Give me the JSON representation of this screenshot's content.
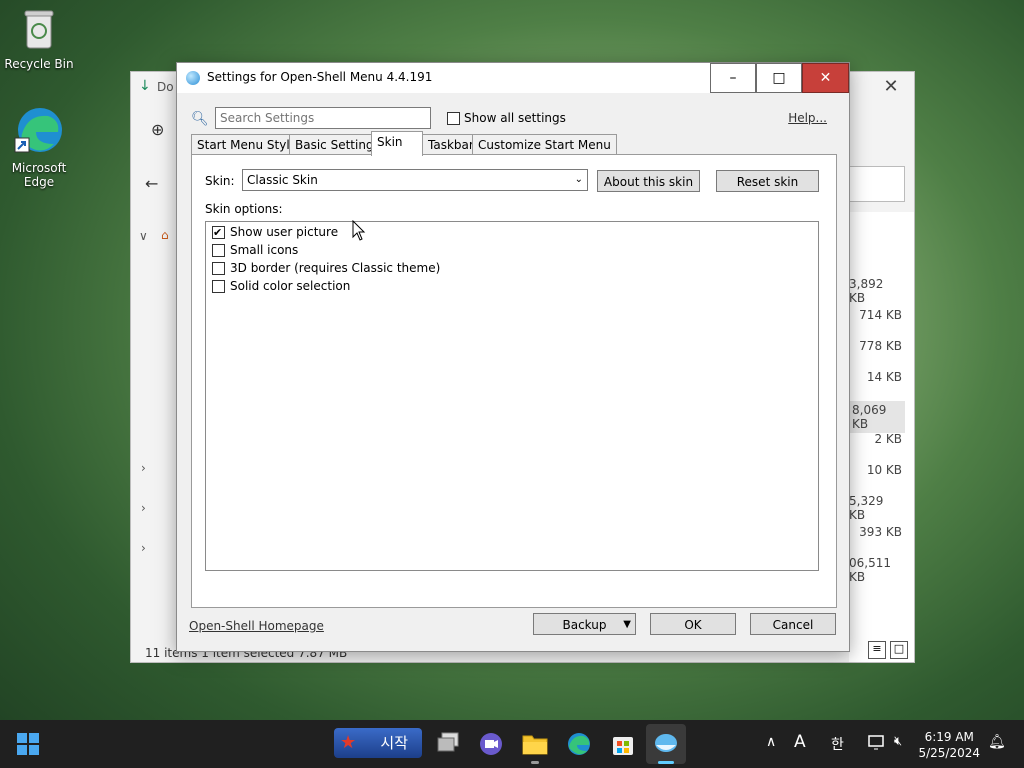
{
  "desktop": {
    "icons": [
      {
        "label": "Recycle Bin"
      },
      {
        "label": "Microsoft Edge"
      }
    ]
  },
  "explorer": {
    "title_partial": "Do",
    "sizes": [
      "3,892 KB",
      "714 KB",
      "778 KB",
      "14 KB",
      "8,069 KB",
      "2 KB",
      "10 KB",
      "5,329 KB",
      "393 KB",
      "06,511 KB"
    ],
    "status": "11 items    1 item selected  7.87 MB"
  },
  "dialog": {
    "title": "Settings for Open-Shell Menu 4.4.191",
    "search_placeholder": "Search Settings",
    "show_all_label": "Show all settings",
    "help_label": "Help...",
    "tabs": [
      {
        "label": "Start Menu Style"
      },
      {
        "label": "Basic Settings"
      },
      {
        "label": "Skin"
      },
      {
        "label": "Taskbar"
      },
      {
        "label": "Customize Start Menu"
      }
    ],
    "skin_label": "Skin:",
    "skin_value": "Classic Skin",
    "about_button": "About this skin",
    "reset_button": "Reset skin",
    "options_label": "Skin options:",
    "options": [
      {
        "label": "Show user picture",
        "checked": true
      },
      {
        "label": "Small icons",
        "checked": false
      },
      {
        "label": "3D border (requires Classic theme)",
        "checked": false
      },
      {
        "label": "Solid color selection",
        "checked": false
      }
    ],
    "homepage_link": "Open-Shell Homepage",
    "backup_button": "Backup",
    "ok_button": "OK",
    "cancel_button": "Cancel"
  },
  "taskbar": {
    "start_korean_label": "시작",
    "ime_letter": "A",
    "ime_korean": "한",
    "time": "6:19 AM",
    "date": "5/25/2024"
  }
}
